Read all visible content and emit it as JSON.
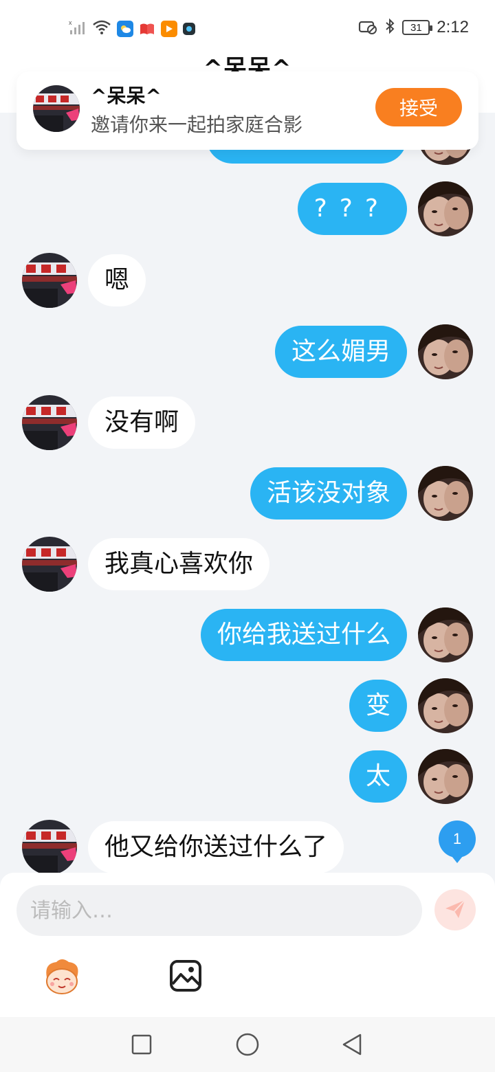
{
  "status_bar": {
    "time": "2:12",
    "battery": "31",
    "icons": [
      "signal-icon",
      "wifi-icon",
      "weather-app-icon",
      "book-app-icon",
      "video-app-icon",
      "app-icon",
      "vpn-icon",
      "bluetooth-icon",
      "battery-icon"
    ]
  },
  "header": {
    "title": "^呆呆^"
  },
  "invite": {
    "name": "^呆呆^",
    "message": "邀请你来一起拍家庭合影",
    "accept_label": "接受"
  },
  "messages": [
    {
      "side": "right",
      "text": "???"
    },
    {
      "side": "left",
      "text": "嗯"
    },
    {
      "side": "right",
      "text": "这么媚男"
    },
    {
      "side": "left",
      "text": "没有啊"
    },
    {
      "side": "right",
      "text": "活该没对象"
    },
    {
      "side": "left",
      "text": "我真心喜欢你"
    },
    {
      "side": "right",
      "text": "你给我送过什么"
    },
    {
      "side": "right",
      "text": "变"
    },
    {
      "side": "right",
      "text": "太"
    },
    {
      "side": "left",
      "text": "他又给你送过什么了"
    }
  ],
  "unread_count": "1",
  "composer": {
    "placeholder": "请输入…",
    "icons": [
      "send-icon",
      "emoji-icon",
      "image-icon"
    ]
  },
  "colors": {
    "accent_blue": "#2ab4f3",
    "accept_orange": "#f97f20",
    "background": "#f2f4f7"
  }
}
